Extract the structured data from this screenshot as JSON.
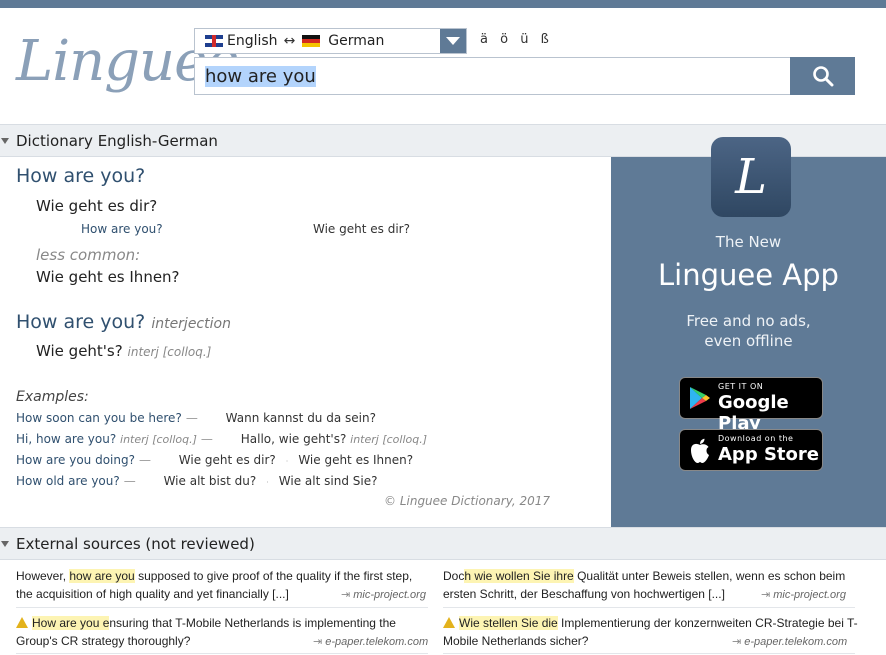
{
  "header": {
    "logo": "Linguee",
    "lang_from": "English",
    "lang_swap": "↔",
    "lang_to": "German",
    "special_chars": [
      "ä",
      "ö",
      "ü",
      "ß"
    ],
    "search_value": "how are you"
  },
  "dictionary": {
    "section_title": "Dictionary English-German",
    "entry1_head": "How are you?",
    "entry1_trans": "Wie geht es dir?",
    "entry1_ex_en": "How are you?",
    "entry1_ex_de": "Wie geht es dir?",
    "less_common": "less common:",
    "entry1_trans2": "Wie geht es Ihnen?",
    "entry2_head": "How are you?",
    "entry2_pos": "interjection",
    "entry2_trans": "Wie geht's?",
    "entry2_tag": "interj  [colloq.]",
    "examples_label": "Examples:",
    "examples": [
      {
        "en": "How soon can you be here?",
        "tag": "",
        "de": "Wann kannst du da sein?",
        "de2": "",
        "de_tag": ""
      },
      {
        "en": "Hi, how are you?",
        "tag": "interj  [colloq.]",
        "de": "Hallo, wie geht's?",
        "de2": "",
        "de_tag": "interj  [colloq.]"
      },
      {
        "en": "How are you doing?",
        "tag": "",
        "de": "Wie geht es dir?",
        "de2": "Wie geht es Ihnen?",
        "de_tag": ""
      },
      {
        "en": "How old are you?",
        "tag": "",
        "de": "Wie alt bist du?",
        "de2": "Wie alt sind Sie?",
        "de_tag": ""
      }
    ],
    "copyright": "© Linguee Dictionary, 2017"
  },
  "promo": {
    "icon_letter": "L",
    "line1": "The New",
    "title": "Linguee App",
    "line2": "Free and no ads,",
    "line3": "even offline",
    "google_small": "GET IT ON",
    "google_big": "Google Play",
    "apple_small": "Download on the",
    "apple_big": "App Store"
  },
  "external": {
    "section_title": "External sources (not reviewed)",
    "rows": [
      {
        "left_pre": "However, ",
        "left_hl": "how are you",
        "left_post": " supposed to give proof of the quality if the first step, the acquisition of high quality and yet financially [...]",
        "left_src": "mic-project.org",
        "right_pre": "Doc",
        "right_hl": "h wie wollen Sie ihre",
        "right_post": " Qualität unter Beweis stellen, wenn es schon beim ersten Schritt, der Beschaffung von hochwertigen [...]",
        "right_src": "mic-project.org"
      },
      {
        "left_pre": "",
        "left_hl": "How are you e",
        "left_post": "nsuring that T-Mobile Netherlands is implementing the Group's CR strategy thoroughly?",
        "left_src": "e-paper.telekom.com",
        "right_pre": "",
        "right_hl": "Wie stellen Sie die",
        "right_post": " Implementierung der konzernweiten CR-Strategie bei T-Mobile Netherlands sicher?",
        "right_src": "e-paper.telekom.com"
      }
    ]
  },
  "colors": {
    "brand": "#5f7a96",
    "link": "#30506f",
    "highlight": "#fdf4b3"
  }
}
